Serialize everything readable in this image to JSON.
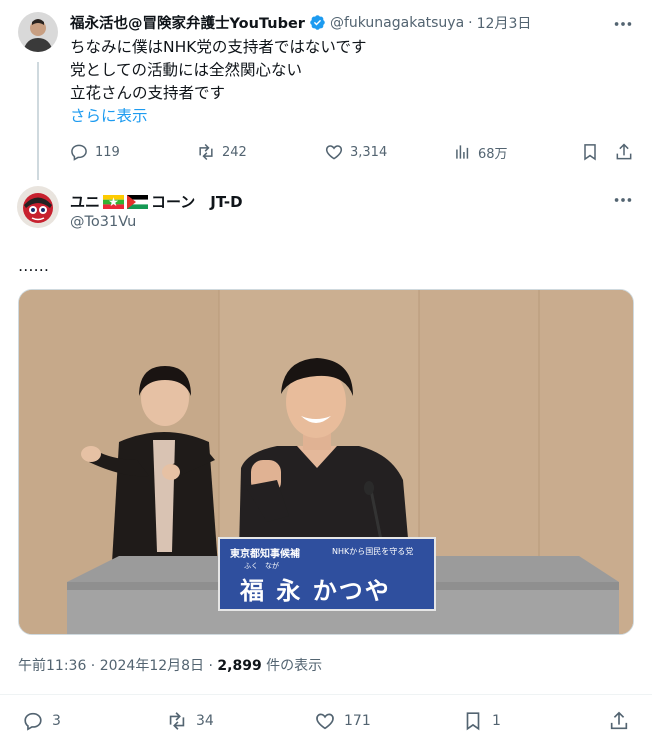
{
  "parent_tweet": {
    "author_name": "福永活也@冒険家弁護士YouTuber",
    "handle": "@fukunagakatsuya",
    "date": "12月3日",
    "lines": [
      "ちなみに僕はNHK党の支持者ではないです",
      "党としての活動には全然関心ない",
      "立花さんの支持者です"
    ],
    "show_more": "さらに表示",
    "replies": "119",
    "reposts": "242",
    "likes": "3,314",
    "views": "68万",
    "dot": "·"
  },
  "focus_tweet": {
    "author_name_prefix": "ユニ",
    "author_name_suffix": "コーン　JT-D",
    "handle": "@To31Vu",
    "text": "……",
    "timestamp": "午前11:36 · 2024年12月8日 · ",
    "view_count": "2,899",
    "view_suffix": " 件の表示",
    "replies": "3",
    "reposts": "34",
    "likes": "171",
    "bookmarks": "1"
  },
  "video": {
    "sign_top_left": "東京都知事候補",
    "sign_top_right": "NHKから国民を守る党",
    "sign_furigana": "ふく　なが",
    "sign_name": "福 永 かつや"
  },
  "icons": {
    "verified": "verified-badge-icon",
    "more": "more-icon",
    "reply": "reply-icon",
    "repost": "repost-icon",
    "like": "like-icon",
    "views": "views-icon",
    "bookmark": "bookmark-icon",
    "share": "share-icon"
  },
  "colors": {
    "accent": "#1d9bf0",
    "muted": "#536471",
    "text": "#0f1419",
    "sign_blue": "#2f4f9e"
  }
}
